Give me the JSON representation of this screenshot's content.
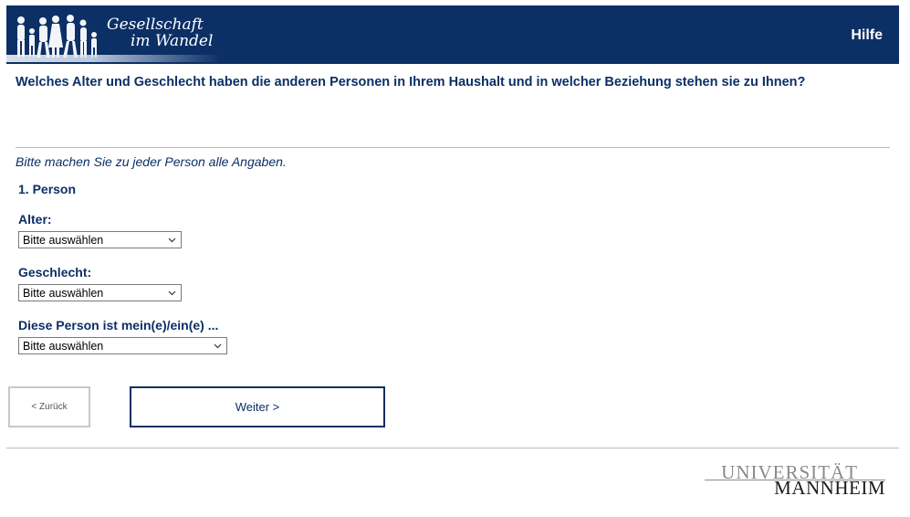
{
  "header": {
    "logo_line1": "Gesellschaft",
    "logo_line2": "im Wandel",
    "help_label": "Hilfe",
    "background": "#0c2f66"
  },
  "question": "Welches Alter und Geschlecht haben die anderen Personen in Ihrem Haushalt und in welcher Beziehung stehen sie zu Ihnen?",
  "instruction": "Bitte machen Sie zu jeder Person alle Angaben.",
  "person_heading": "1. Person",
  "fields": [
    {
      "label": "Alter:",
      "selected": "Bitte auswählen"
    },
    {
      "label": "Geschlecht:",
      "selected": "Bitte auswählen"
    },
    {
      "label": "Diese Person ist mein(e)/ein(e) ...",
      "selected": "Bitte auswählen"
    }
  ],
  "nav": {
    "back_label": "< Zurück",
    "next_label": "Weiter >"
  },
  "footer": {
    "university_line1": "UNIVERSITÄT",
    "university_line2": "MANNHEIM"
  },
  "colors": {
    "primary": "#0c2f66",
    "divider": "#bdbdbd"
  }
}
